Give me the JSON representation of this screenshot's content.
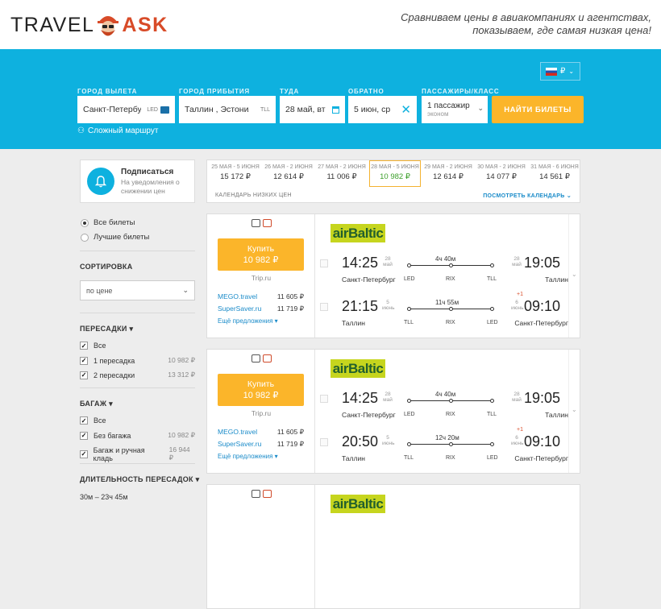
{
  "header": {
    "logo_left": "TRAVEL",
    "logo_right": "ASK",
    "slogan_line1": "Сравниваем цены в авиакомпаниях и агентствах,",
    "slogan_line2": "показываем, где самая низкая цена!"
  },
  "search": {
    "currency": "₽",
    "from": {
      "label": "ГОРОД ВЫЛЕТА",
      "value": "Санкт-Петербург",
      "code": "LED"
    },
    "to": {
      "label": "ГОРОД ПРИБЫТИЯ",
      "value": "Таллин , Эстония",
      "code": "TLL"
    },
    "depart": {
      "label": "ТУДА",
      "value": "28 май, вт"
    },
    "return": {
      "label": "ОБРАТНО",
      "value": "5 июн, ср"
    },
    "pax": {
      "label": "ПАССАЖИРЫ/КЛАСС",
      "value": "1 пассажир",
      "class": "эконом"
    },
    "button": "НАЙТИ БИЛЕТЫ",
    "complex_route": "Сложный маршрут"
  },
  "subscribe": {
    "title": "Подписаться",
    "text": "На уведомления о снижении цен"
  },
  "calendar": {
    "days": [
      {
        "range": "25 МАЯ - 5 ИЮНЯ",
        "price": "15 172 ₽"
      },
      {
        "range": "26 МАЯ - 2 ИЮНЯ",
        "price": "12 614 ₽"
      },
      {
        "range": "27 МАЯ - 2 ИЮНЯ",
        "price": "11 006 ₽"
      },
      {
        "range": "28 МАЯ - 5 ИЮНЯ",
        "price": "10 982 ₽"
      },
      {
        "range": "29 МАЯ - 2 ИЮНЯ",
        "price": "12 614 ₽"
      },
      {
        "range": "30 МАЯ - 2 ИЮНЯ",
        "price": "14 077 ₽"
      },
      {
        "range": "31 МАЯ - 6 ИЮНЯ",
        "price": "14 561 ₽"
      }
    ],
    "caption": "КАЛЕНДАРЬ НИЗКИХ ЦЕН",
    "link": "ПОСМОТРЕТЬ КАЛЕНДАРЬ"
  },
  "filters": {
    "all_tickets": "Все билеты",
    "best_tickets": "Лучшие билеты",
    "sort_title": "СОРТИРОВКА",
    "sort_value": "по цене",
    "transfers_title": "ПЕРЕСАДКИ",
    "transfers": [
      {
        "label": "Все",
        "count": ""
      },
      {
        "label": "1 пересадка",
        "count": "10 982 ₽"
      },
      {
        "label": "2 пересадки",
        "count": "13 312 ₽"
      }
    ],
    "baggage_title": "БАГАЖ",
    "baggage": [
      {
        "label": "Все",
        "count": ""
      },
      {
        "label": "Без багажа",
        "count": "10 982 ₽"
      },
      {
        "label": "Багаж и ручная кладь",
        "count": "16 944 ₽"
      }
    ],
    "duration_title": "ДЛИТЕЛЬНОСТЬ ПЕРЕСАДОК",
    "duration_value": "30м – 23ч 45м"
  },
  "cards": [
    {
      "buy": "Купить",
      "price": "10 982 ₽",
      "via": "Trip.ru",
      "offers": [
        {
          "name": "MEGO.travel",
          "price": "11 605 ₽"
        },
        {
          "name": "SuperSaver.ru",
          "price": "11 719 ₽"
        }
      ],
      "more": "Ещё предложения",
      "airline": "airBaltic",
      "legs": [
        {
          "dep": "14:25",
          "dep_d": "28",
          "dep_m": "май",
          "from": "Санкт-Петербург",
          "a1": "LED",
          "dur": "4ч 40м",
          "a2": "RIX",
          "a3": "TLL",
          "arr": "19:05",
          "arr_d": "28",
          "arr_m": "май",
          "to": "Таллин",
          "plus": ""
        },
        {
          "dep": "21:15",
          "dep_d": "5",
          "dep_m": "июнь",
          "from": "Таллин",
          "a1": "TLL",
          "dur": "11ч 55м",
          "a2": "RIX",
          "a3": "LED",
          "arr": "09:10",
          "arr_d": "6",
          "arr_m": "июнь",
          "to": "Санкт-Петербург",
          "plus": "+1"
        }
      ]
    },
    {
      "buy": "Купить",
      "price": "10 982 ₽",
      "via": "Trip.ru",
      "offers": [
        {
          "name": "MEGO.travel",
          "price": "11 605 ₽"
        },
        {
          "name": "SuperSaver.ru",
          "price": "11 719 ₽"
        }
      ],
      "more": "Ещё предложения",
      "airline": "airBaltic",
      "legs": [
        {
          "dep": "14:25",
          "dep_d": "28",
          "dep_m": "май",
          "from": "Санкт-Петербург",
          "a1": "LED",
          "dur": "4ч 40м",
          "a2": "RIX",
          "a3": "TLL",
          "arr": "19:05",
          "arr_d": "28",
          "arr_m": "май",
          "to": "Таллин",
          "plus": ""
        },
        {
          "dep": "20:50",
          "dep_d": "5",
          "dep_m": "июнь",
          "from": "Таллин",
          "a1": "TLL",
          "dur": "12ч 20м",
          "a2": "RIX",
          "a3": "LED",
          "arr": "09:10",
          "arr_d": "6",
          "arr_m": "июнь",
          "to": "Санкт-Петербург",
          "plus": "+1"
        }
      ]
    },
    {
      "airline": "airBaltic"
    }
  ]
}
